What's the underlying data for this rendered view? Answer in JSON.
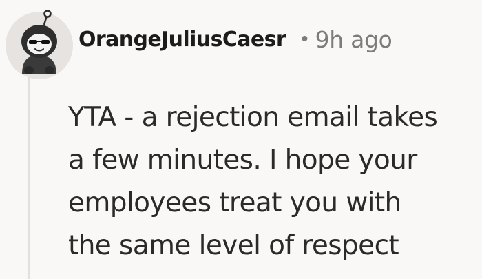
{
  "comment": {
    "author": "OrangeJuliusCaesr",
    "separator": "•",
    "timestamp": "9h ago",
    "avatar_icon": "snoo-avatar-icon",
    "body_lines": [
      "YTA - a rejection email takes",
      "a few minutes. I hope your",
      "employees treat you with",
      "the same level of respect"
    ]
  },
  "colors": {
    "background": "#faf8f6",
    "text": "#1c1c1c",
    "meta": "#7c7c7c",
    "thread_line": "#e3dfdb"
  }
}
